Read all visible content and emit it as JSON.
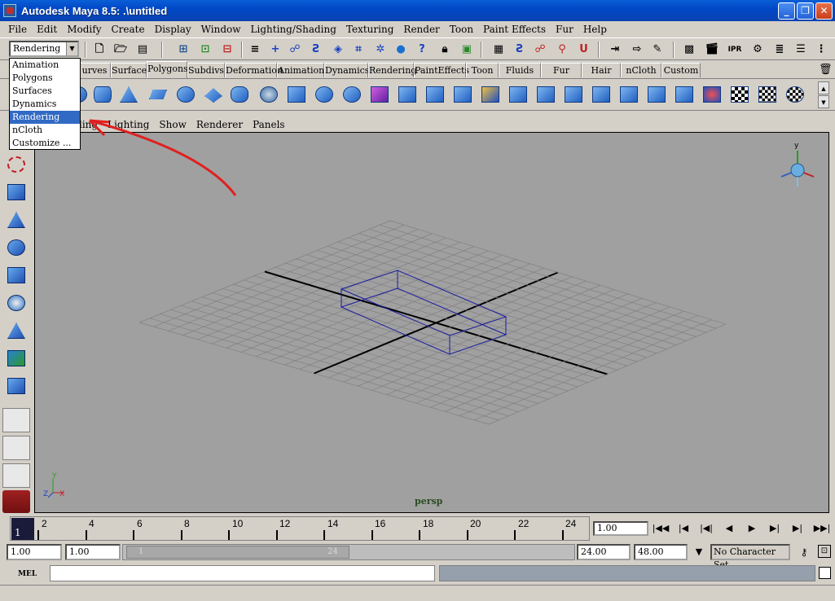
{
  "window": {
    "title": "Autodesk Maya 8.5: .\\untitled",
    "min": "_",
    "max": "❐",
    "close": "✕"
  },
  "menubar": [
    "File",
    "Edit",
    "Modify",
    "Create",
    "Display",
    "Window",
    "Lighting/Shading",
    "Texturing",
    "Render",
    "Toon",
    "Paint Effects",
    "Fur",
    "Help"
  ],
  "statusline": {
    "menuset_value": "Rendering",
    "arrow": "▼"
  },
  "shelf_tabs": [
    "urves",
    "Surfaces",
    "Polygons",
    "Subdivs",
    "Deformation",
    "Animation",
    "Dynamics",
    "Rendering",
    "PaintEffects",
    "Toon",
    "Fluids",
    "Fur",
    "Hair",
    "nCloth",
    "Custom"
  ],
  "shelf_active_tab": "Polygons",
  "menuset_dropdown": {
    "items": [
      "Animation",
      "Polygons",
      "Surfaces",
      "Dynamics",
      "Rendering",
      "nCloth",
      "Customize ..."
    ],
    "selected": "Rendering"
  },
  "panel_menu": [
    "ading",
    "Lighting",
    "Show",
    "Renderer",
    "Panels"
  ],
  "viewport": {
    "camera_label": "persp",
    "axis_x": "X",
    "axis_y": "Y",
    "axis_z": "Z",
    "view_cube_y": "y"
  },
  "timeline": {
    "current_frame": "1",
    "ticks": [
      "2",
      "4",
      "6",
      "8",
      "10",
      "12",
      "14",
      "16",
      "18",
      "20",
      "22",
      "24"
    ],
    "current_time_field": "1.00",
    "playback": [
      "|◀◀",
      "|◀",
      "|◀|",
      "◀",
      "▶",
      "▶|",
      "▶|",
      "▶▶|"
    ]
  },
  "range": {
    "start_time": "1.00",
    "playback_start": "1.00",
    "range_start_label": "1",
    "range_end_label": "24",
    "playback_end": "24.00",
    "end_time": "48.00",
    "character_set": "No Character Set"
  },
  "command_line": {
    "mel_label": "MEL",
    "input_value": ""
  },
  "colors": {
    "title_blue": "#0048c8",
    "viewport_bg": "#a0a0a0",
    "grid": "#808080",
    "cube": "#1a1aa0",
    "annotation": "#e02020"
  }
}
